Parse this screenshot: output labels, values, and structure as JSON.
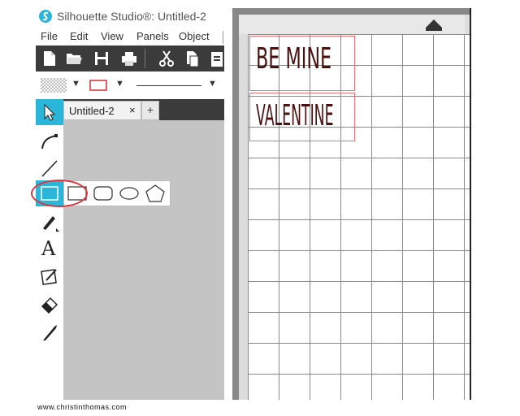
{
  "app": {
    "title": "Silhouette Studio®: Untitled-2",
    "menus": [
      "File",
      "Edit",
      "View",
      "Panels",
      "Object"
    ]
  },
  "tabs": {
    "document": "Untitled-2",
    "close_glyph": "×",
    "add_glyph": "+"
  },
  "tools": {
    "left": [
      "select-pointer-icon",
      "point-edit-icon",
      "line-tool-icon",
      "rectangle-tool-icon",
      "draw-pen-icon",
      "text-tool-icon",
      "sketch-pad-icon",
      "eraser-icon",
      "knife-tool-icon"
    ],
    "active": "rectangle-tool-icon",
    "shape_flyout": [
      "rectangle",
      "rounded-rectangle",
      "ellipse",
      "polygon"
    ]
  },
  "design": {
    "line1": "BE MINE",
    "line2": "VALENTINE",
    "text_color": "#4a1010",
    "bbox_color": "#e57373"
  },
  "colors": {
    "accent": "#29b6d9",
    "toolbar": "#3b3b3b",
    "annotation": "#d9363e"
  },
  "watermark": "www.christinthomas.com"
}
